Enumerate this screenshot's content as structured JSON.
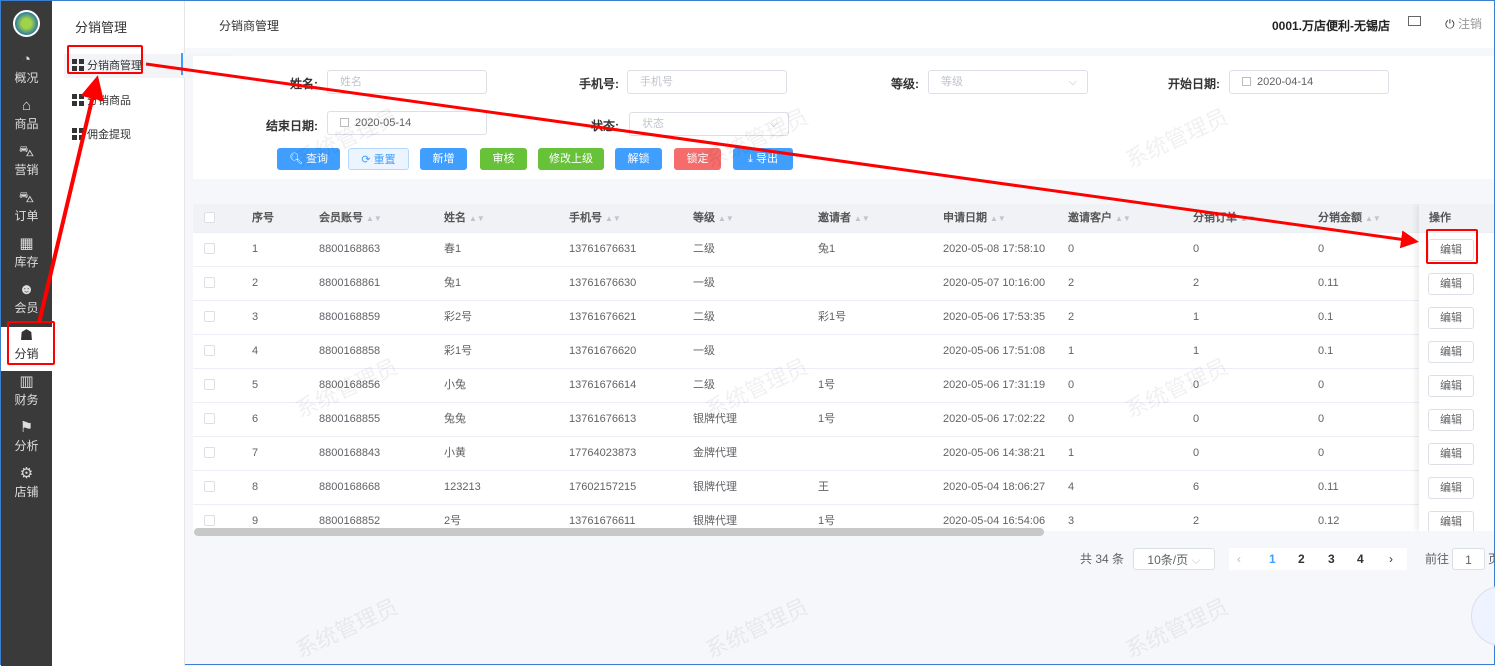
{
  "sidebar": {
    "items": [
      {
        "label": "概况",
        "icon": "dashboard-icon",
        "glyph": "◔"
      },
      {
        "label": "商品",
        "icon": "goods-icon",
        "glyph": "⌂"
      },
      {
        "label": "营销",
        "icon": "cart-icon",
        "glyph": "⛍"
      },
      {
        "label": "订单",
        "icon": "order-cart-icon",
        "glyph": "⛍"
      },
      {
        "label": "库存",
        "icon": "inventory-icon",
        "glyph": "▦"
      },
      {
        "label": "会员",
        "icon": "member-icon",
        "glyph": "☻"
      },
      {
        "label": "分销",
        "icon": "distribution-icon",
        "glyph": "☗"
      },
      {
        "label": "财务",
        "icon": "finance-icon",
        "glyph": "▥"
      },
      {
        "label": "分析",
        "icon": "analysis-icon",
        "glyph": "⚑"
      },
      {
        "label": "店铺",
        "icon": "store-settings-icon",
        "glyph": "⚙"
      }
    ],
    "active": "分销"
  },
  "submenu": {
    "title": "分销管理",
    "items": [
      "分销商管理",
      "分销商品",
      "佣金提现"
    ]
  },
  "header": {
    "breadcrumb": "分销商管理",
    "store": "0001.万店便利-无锡店",
    "logout": "注销"
  },
  "filters": {
    "name_label": "姓名:",
    "name_placeholder": "姓名",
    "phone_label": "手机号:",
    "phone_placeholder": "手机号",
    "level_label": "等级:",
    "level_placeholder": "等级",
    "start_label": "开始日期:",
    "start_value": "2020-04-14",
    "end_label": "结束日期:",
    "end_value": "2020-05-14",
    "status_label": "状态:",
    "status_placeholder": "状态"
  },
  "buttons": {
    "query": "查询",
    "reset": "重置",
    "add": "新增",
    "audit": "审核",
    "change_parent": "修改上级",
    "unlock": "解锁",
    "lock": "锁定",
    "export": "导出"
  },
  "table": {
    "headers": [
      "序号",
      "会员账号",
      "姓名",
      "手机号",
      "等级",
      "邀请者",
      "申请日期",
      "邀请客户",
      "分销订单",
      "分销金额",
      "操作"
    ],
    "rows": [
      [
        "1",
        "8800168863",
        "春1",
        "13761676631",
        "二级",
        "兔1",
        "2020-05-08 17:58:10",
        "0",
        "0",
        "0"
      ],
      [
        "2",
        "8800168861",
        "兔1",
        "13761676630",
        "一级",
        "",
        "2020-05-07 10:16:00",
        "2",
        "2",
        "0.11"
      ],
      [
        "3",
        "8800168859",
        "彩2号",
        "13761676621",
        "二级",
        "彩1号",
        "2020-05-06 17:53:35",
        "2",
        "1",
        "0.1"
      ],
      [
        "4",
        "8800168858",
        "彩1号",
        "13761676620",
        "一级",
        "",
        "2020-05-06 17:51:08",
        "1",
        "1",
        "0.1"
      ],
      [
        "5",
        "8800168856",
        "小兔",
        "13761676614",
        "二级",
        "1号",
        "2020-05-06 17:31:19",
        "0",
        "0",
        "0"
      ],
      [
        "6",
        "8800168855",
        "兔兔",
        "13761676613",
        "银牌代理",
        "1号",
        "2020-05-06 17:02:22",
        "0",
        "0",
        "0"
      ],
      [
        "7",
        "8800168843",
        "小黄",
        "17764023873",
        "金牌代理",
        "",
        "2020-05-06 14:38:21",
        "1",
        "0",
        "0"
      ],
      [
        "8",
        "8800168668",
        "123213",
        "17602157215",
        "银牌代理",
        "王",
        "2020-05-04 18:06:27",
        "4",
        "6",
        "0.11"
      ],
      [
        "9",
        "8800168852",
        "2号",
        "13761676611",
        "银牌代理",
        "1号",
        "2020-05-04 16:54:06",
        "3",
        "2",
        "0.12"
      ]
    ],
    "edit_label": "编辑"
  },
  "pagination": {
    "total": "共 34 条",
    "page_size": "10条/页",
    "pages": [
      "1",
      "2",
      "3",
      "4"
    ],
    "current": "1",
    "goto_label": "前往",
    "goto_value": "1",
    "page_suffix": "页"
  },
  "watermark": "系统管理员"
}
